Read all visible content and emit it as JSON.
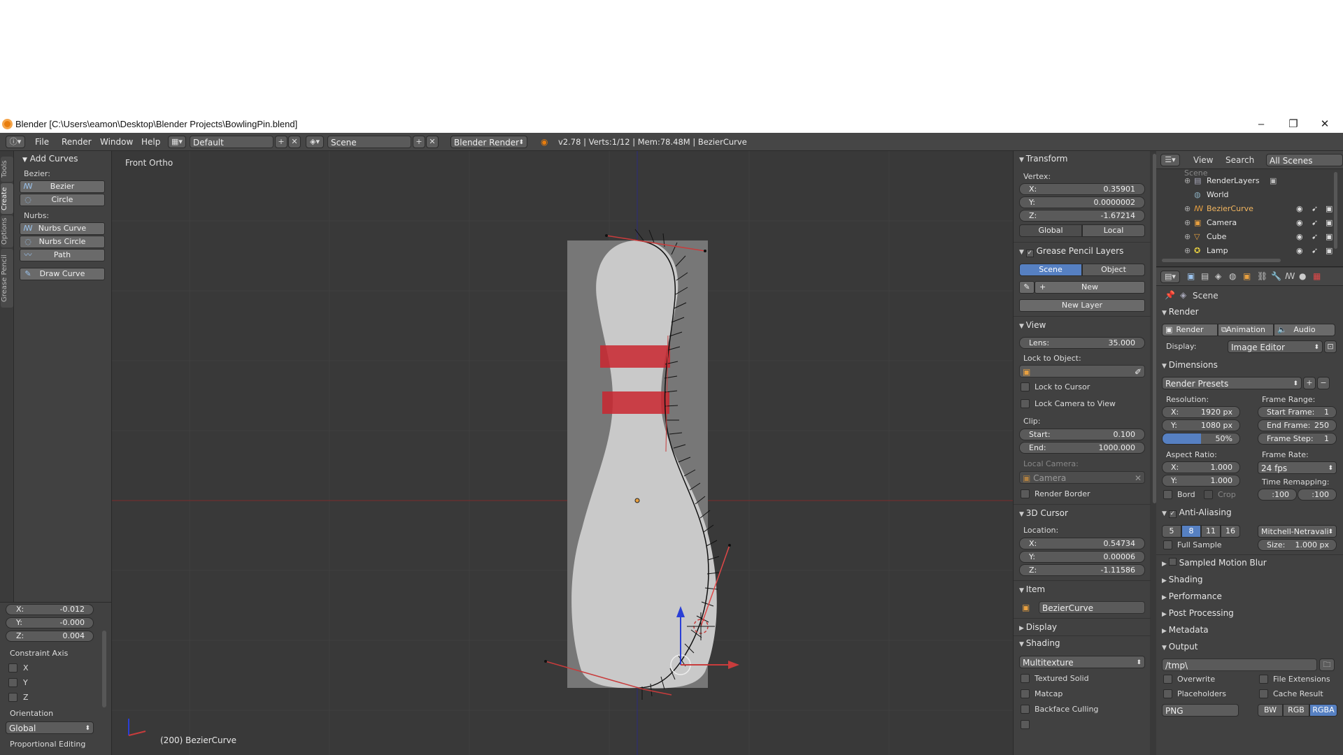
{
  "window": {
    "title": "Blender [C:\\Users\\eamon\\Desktop\\Blender Projects\\BowlingPin.blend]"
  },
  "menubar": {
    "items": [
      "File",
      "Render",
      "Window",
      "Help"
    ],
    "layout": "Default",
    "scene": "Scene",
    "engine": "Blender Render",
    "stats": "v2.78 | Verts:1/12 | Mem:78.48M | BezierCurve"
  },
  "tabs": [
    "Tools",
    "Create",
    "Options",
    "Grease Pencil"
  ],
  "tool_shelf": {
    "header": "Add Curves",
    "bezier_label": "Bezier:",
    "bezier_buttons": [
      "Bezier",
      "Circle"
    ],
    "nurbs_label": "Nurbs:",
    "nurbs_buttons": [
      "Nurbs Curve",
      "Nurbs Circle",
      "Path"
    ],
    "draw_curve": "Draw Curve"
  },
  "redo_panel": {
    "x": "-0.012",
    "y": "-0.000",
    "z": "0.004",
    "x_label": "X:",
    "y_label": "Y:",
    "z_label": "Z:",
    "constraint_axis": "Constraint Axis",
    "axes": [
      "X",
      "Y",
      "Z"
    ],
    "orientation_label": "Orientation",
    "orientation": "Global",
    "proportional": "Proportional Editing"
  },
  "viewport": {
    "view_name": "Front Ortho",
    "status": "(200) BezierCurve"
  },
  "npanel": {
    "transform": {
      "header": "Transform",
      "vertex_label": "Vertex:",
      "x": "0.35901",
      "y": "0.0000002",
      "z": "-1.67214",
      "global": "Global",
      "local": "Local"
    },
    "grease_pencil": {
      "header": "Grease Pencil Layers",
      "scene": "Scene",
      "object": "Object",
      "new": "New",
      "new_layer": "New Layer"
    },
    "view": {
      "header": "View",
      "lens_label": "Lens:",
      "lens": "35.000",
      "lock_to_object": "Lock to Object:",
      "lock_to_cursor": "Lock to Cursor",
      "lock_camera": "Lock Camera to View",
      "clip": "Clip:",
      "start_label": "Start:",
      "start": "0.100",
      "end_label": "End:",
      "end": "1000.000",
      "local_camera": "Local Camera:",
      "camera": "Camera",
      "render_border": "Render Border"
    },
    "cursor": {
      "header": "3D Cursor",
      "location": "Location:",
      "x": "0.54734",
      "y": "0.00006",
      "z": "-1.11586"
    },
    "item": {
      "header": "Item",
      "name": "BezierCurve"
    },
    "display": {
      "header": "Display"
    },
    "shading": {
      "header": "Shading",
      "mode": "Multitexture",
      "options": [
        "Textured Solid",
        "Matcap",
        "Backface Culling"
      ]
    }
  },
  "outliner": {
    "view": "View",
    "search": "Search",
    "filter": "All Scenes",
    "rows": [
      {
        "name": "Scene"
      },
      {
        "name": "RenderLayers"
      },
      {
        "name": "World"
      },
      {
        "name": "BezierCurve"
      },
      {
        "name": "Camera"
      },
      {
        "name": "Cube"
      },
      {
        "name": "Lamp"
      }
    ]
  },
  "properties": {
    "context": "Scene",
    "render": {
      "header": "Render",
      "buttons": [
        "Render",
        "Animation",
        "Audio"
      ],
      "display_label": "Display:",
      "display": "Image Editor"
    },
    "dimensions": {
      "header": "Dimensions",
      "presets": "Render Presets",
      "resolution": "Resolution:",
      "res_x": "1920 px",
      "res_y": "1080 px",
      "res_pct": "50%",
      "frame_range": "Frame Range:",
      "start_frame_label": "Start Frame:",
      "start_frame": "1",
      "end_frame_label": "End Frame:",
      "end_frame": "250",
      "frame_step_label": "Frame Step:",
      "frame_step": "1",
      "aspect_ratio": "Aspect Ratio:",
      "aspect_x": "1.000",
      "aspect_y": "1.000",
      "frame_rate": "Frame Rate:",
      "fps": "24 fps",
      "bord": "Bord",
      "crop": "Crop",
      "time_remapping": "Time Remapping:",
      "remap_old": ":100",
      "remap_new": ":100"
    },
    "anti_aliasing": {
      "header": "Anti-Aliasing",
      "samples": [
        "5",
        "8",
        "11",
        "16"
      ],
      "filter": "Mitchell-Netravali",
      "full_sample": "Full Sample",
      "size_label": "Size:",
      "size": "1.000 px"
    },
    "collapsed": [
      "Sampled Motion Blur",
      "Shading",
      "Performance",
      "Post Processing",
      "Metadata"
    ],
    "output": {
      "header": "Output",
      "path": "/tmp\\",
      "overwrite": "Overwrite",
      "file_extensions": "File Extensions",
      "placeholders": "Placeholders",
      "cache_result": "Cache Result",
      "format": "PNG",
      "channels": [
        "BW",
        "RGB",
        "RGBA"
      ]
    }
  },
  "colors": {
    "accent": "#5680c2",
    "axis_x": "#c83c3c",
    "axis_z": "#2a3fd6",
    "stripe": "#c9262f"
  }
}
